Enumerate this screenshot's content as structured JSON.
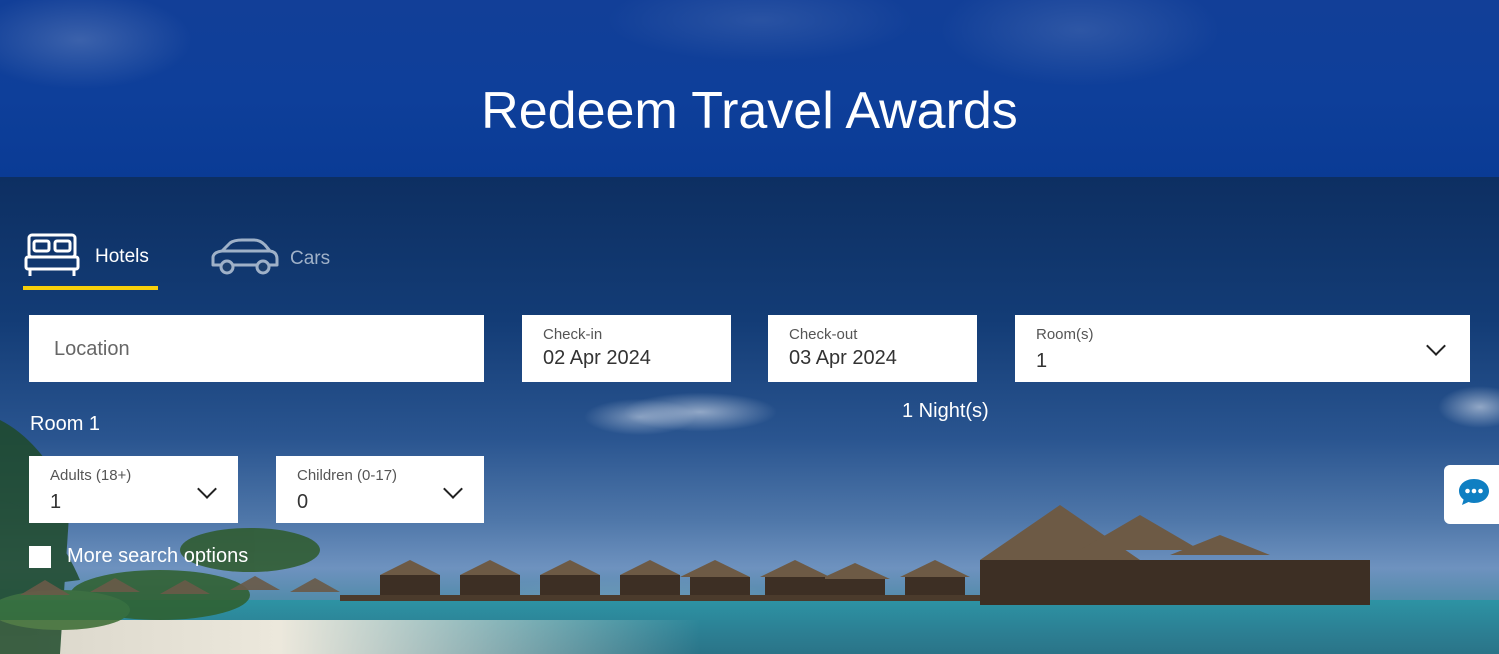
{
  "page": {
    "title": "Redeem Travel Awards"
  },
  "tabs": [
    {
      "label": "Hotels",
      "icon": "bed-icon",
      "active": true
    },
    {
      "label": "Cars",
      "icon": "car-icon",
      "active": false
    }
  ],
  "search": {
    "location": {
      "placeholder": "Location",
      "value": ""
    },
    "checkin": {
      "label": "Check-in",
      "value": "02 Apr 2024"
    },
    "checkout": {
      "label": "Check-out",
      "value": "03 Apr 2024"
    },
    "rooms": {
      "label": "Room(s)",
      "value": "1"
    },
    "nights": "1 Night(s)",
    "room_heading": "Room 1",
    "adults": {
      "label": "Adults (18+)",
      "value": "1"
    },
    "children": {
      "label": "Children (0-17)",
      "value": "0"
    },
    "more_options": {
      "label": "More search options",
      "checked": false
    }
  },
  "chat": {
    "icon": "chat-icon"
  },
  "colors": {
    "accent": "#f7cf0a",
    "header_blue": "#0e3f9a",
    "chat_icon": "#0f7fc2"
  }
}
